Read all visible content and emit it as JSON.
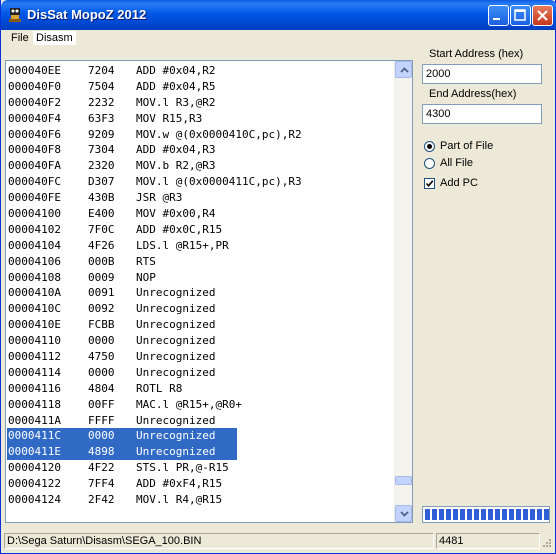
{
  "window": {
    "title": "DisSat MopoZ 2012"
  },
  "menu": [
    {
      "label": "File"
    },
    {
      "label": "Disasm"
    }
  ],
  "listing": [
    {
      "addr": "000040EE",
      "hex": "7204",
      "ins": "ADD #0x04,R2"
    },
    {
      "addr": "000040F0",
      "hex": "7504",
      "ins": "ADD #0x04,R5"
    },
    {
      "addr": "000040F2",
      "hex": "2232",
      "ins": "MOV.l R3,@R2"
    },
    {
      "addr": "000040F4",
      "hex": "63F3",
      "ins": "MOV R15,R3"
    },
    {
      "addr": "000040F6",
      "hex": "9209",
      "ins": "MOV.w @(0x0000410C,pc),R2"
    },
    {
      "addr": "000040F8",
      "hex": "7304",
      "ins": "ADD #0x04,R3"
    },
    {
      "addr": "000040FA",
      "hex": "2320",
      "ins": "MOV.b R2,@R3"
    },
    {
      "addr": "000040FC",
      "hex": "D307",
      "ins": "MOV.l @(0x0000411C,pc),R3"
    },
    {
      "addr": "000040FE",
      "hex": "430B",
      "ins": "JSR @R3"
    },
    {
      "addr": "00004100",
      "hex": "E400",
      "ins": "MOV #0x00,R4"
    },
    {
      "addr": "00004102",
      "hex": "7F0C",
      "ins": "ADD #0x0C,R15"
    },
    {
      "addr": "00004104",
      "hex": "4F26",
      "ins": "LDS.l @R15+,PR"
    },
    {
      "addr": "00004106",
      "hex": "000B",
      "ins": "RTS"
    },
    {
      "addr": "00004108",
      "hex": "0009",
      "ins": "NOP"
    },
    {
      "addr": "0000410A",
      "hex": "0091",
      "ins": "Unrecognized"
    },
    {
      "addr": "0000410C",
      "hex": "0092",
      "ins": "Unrecognized"
    },
    {
      "addr": "0000410E",
      "hex": "FCBB",
      "ins": "Unrecognized"
    },
    {
      "addr": "00004110",
      "hex": "0000",
      "ins": "Unrecognized"
    },
    {
      "addr": "00004112",
      "hex": "4750",
      "ins": "Unrecognized"
    },
    {
      "addr": "00004114",
      "hex": "0000",
      "ins": "Unrecognized"
    },
    {
      "addr": "00004116",
      "hex": "4804",
      "ins": "ROTL R8"
    },
    {
      "addr": "00004118",
      "hex": "00FF",
      "ins": "MAC.l @R15+,@R0+"
    },
    {
      "addr": "0000411A",
      "hex": "FFFF",
      "ins": "Unrecognized"
    },
    {
      "addr": "0000411C",
      "hex": "0000",
      "ins": "Unrecognized"
    },
    {
      "addr": "0000411E",
      "hex": "4898",
      "ins": "Unrecognized"
    },
    {
      "addr": "00004120",
      "hex": "4F22",
      "ins": "STS.l PR,@-R15"
    },
    {
      "addr": "00004122",
      "hex": "7FF4",
      "ins": "ADD #0xF4,R15"
    },
    {
      "addr": "00004124",
      "hex": "2F42",
      "ins": "MOV.l R4,@R15"
    }
  ],
  "selected_rows": [
    23,
    24
  ],
  "options": {
    "start_label": "Start Address (hex)",
    "start_value": "2000",
    "end_label": "End Address(hex)",
    "end_value": "4300",
    "part_of_file": "Part of File",
    "all_file": "All File",
    "add_pc": "Add PC",
    "mode": "Part of File",
    "add_pc_checked": true
  },
  "progress": {
    "blocks": 18,
    "percent": 100,
    "color": "#2f5fd6"
  },
  "status": {
    "path": "D:\\Sega Saturn\\Disasm\\SEGA_100.BIN",
    "count": "4481"
  }
}
